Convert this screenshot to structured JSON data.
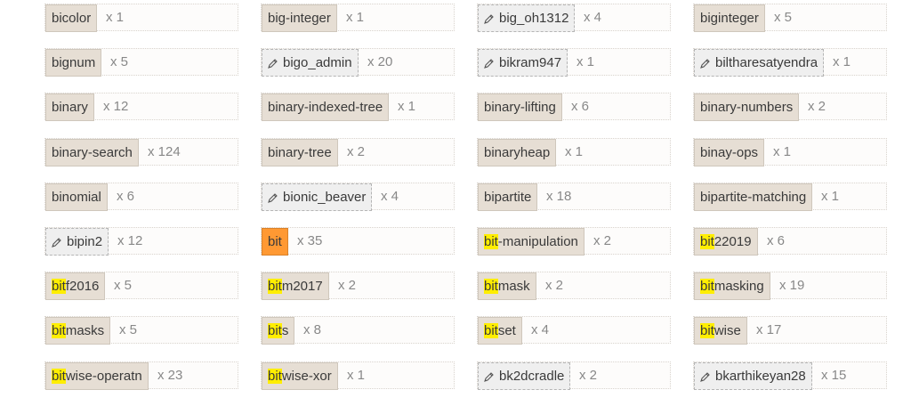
{
  "tags": [
    {
      "prefix": "",
      "hl": "",
      "rest": "bicolor",
      "count": "x 1",
      "syn": false
    },
    {
      "prefix": "",
      "hl": "",
      "rest": "big-integer",
      "count": "x 1",
      "syn": false
    },
    {
      "prefix": "",
      "hl": "",
      "rest": "big_oh1312",
      "count": "x 4",
      "syn": true
    },
    {
      "prefix": "",
      "hl": "",
      "rest": "biginteger",
      "count": "x 5",
      "syn": false
    },
    {
      "prefix": "",
      "hl": "",
      "rest": "bignum",
      "count": "x 5",
      "syn": false
    },
    {
      "prefix": "",
      "hl": "",
      "rest": "bigo_admin",
      "count": "x 20",
      "syn": true
    },
    {
      "prefix": "",
      "hl": "",
      "rest": "bikram947",
      "count": "x 1",
      "syn": true
    },
    {
      "prefix": "",
      "hl": "",
      "rest": "biltharesatyendra",
      "count": "x 1",
      "syn": true
    },
    {
      "prefix": "",
      "hl": "",
      "rest": "binary",
      "count": "x 12",
      "syn": false
    },
    {
      "prefix": "",
      "hl": "",
      "rest": "binary-indexed-tree",
      "count": "x 1",
      "syn": false
    },
    {
      "prefix": "",
      "hl": "",
      "rest": "binary-lifting",
      "count": "x 6",
      "syn": false
    },
    {
      "prefix": "",
      "hl": "",
      "rest": "binary-numbers",
      "count": "x 2",
      "syn": false
    },
    {
      "prefix": "",
      "hl": "",
      "rest": "binary-search",
      "count": "x 124",
      "syn": false
    },
    {
      "prefix": "",
      "hl": "",
      "rest": "binary-tree",
      "count": "x 2",
      "syn": false
    },
    {
      "prefix": "",
      "hl": "",
      "rest": "binaryheap",
      "count": "x 1",
      "syn": false
    },
    {
      "prefix": "",
      "hl": "",
      "rest": "binay-ops",
      "count": "x 1",
      "syn": false
    },
    {
      "prefix": "",
      "hl": "",
      "rest": "binomial",
      "count": "x 6",
      "syn": false
    },
    {
      "prefix": "",
      "hl": "",
      "rest": "bionic_beaver",
      "count": "x 4",
      "syn": true
    },
    {
      "prefix": "",
      "hl": "",
      "rest": "bipartite",
      "count": "x 18",
      "syn": false
    },
    {
      "prefix": "",
      "hl": "",
      "rest": "bipartite-matching",
      "count": "x 1",
      "syn": false
    },
    {
      "prefix": "",
      "hl": "",
      "rest": "bipin2",
      "count": "x 12",
      "syn": true
    },
    {
      "prefix": "",
      "hl": "bit",
      "rest": "",
      "count": "x 35",
      "syn": false,
      "exact": true
    },
    {
      "prefix": "",
      "hl": "bit",
      "rest": "-manipulation",
      "count": "x 2",
      "syn": false
    },
    {
      "prefix": "",
      "hl": "bit",
      "rest": "22019",
      "count": "x 6",
      "syn": false
    },
    {
      "prefix": "",
      "hl": "bit",
      "rest": "f2016",
      "count": "x 5",
      "syn": false
    },
    {
      "prefix": "",
      "hl": "bit",
      "rest": "m2017",
      "count": "x 2",
      "syn": false
    },
    {
      "prefix": "",
      "hl": "bit",
      "rest": "mask",
      "count": "x 2",
      "syn": false
    },
    {
      "prefix": "",
      "hl": "bit",
      "rest": "masking",
      "count": "x 19",
      "syn": false
    },
    {
      "prefix": "",
      "hl": "bit",
      "rest": "masks",
      "count": "x 5",
      "syn": false
    },
    {
      "prefix": "",
      "hl": "bit",
      "rest": "s",
      "count": "x 8",
      "syn": false
    },
    {
      "prefix": "",
      "hl": "bit",
      "rest": "set",
      "count": "x 4",
      "syn": false
    },
    {
      "prefix": "",
      "hl": "bit",
      "rest": "wise",
      "count": "x 17",
      "syn": false
    },
    {
      "prefix": "",
      "hl": "bit",
      "rest": "wise-operatn",
      "count": "x 23",
      "syn": false
    },
    {
      "prefix": "",
      "hl": "bit",
      "rest": "wise-xor",
      "count": "x 1",
      "syn": false
    },
    {
      "prefix": "",
      "hl": "",
      "rest": "bk2dcradle",
      "count": "x 2",
      "syn": true
    },
    {
      "prefix": "",
      "hl": "",
      "rest": "bkarthikeyan28",
      "count": "x 15",
      "syn": true
    }
  ],
  "colors": {
    "tag_bg": "#e6ded4",
    "synonym_bg": "#efefef",
    "highlight": "#ffee00",
    "exact_match": "#ff9933",
    "count_text": "#888888"
  },
  "icons": {
    "synonym": "pencil-icon"
  }
}
